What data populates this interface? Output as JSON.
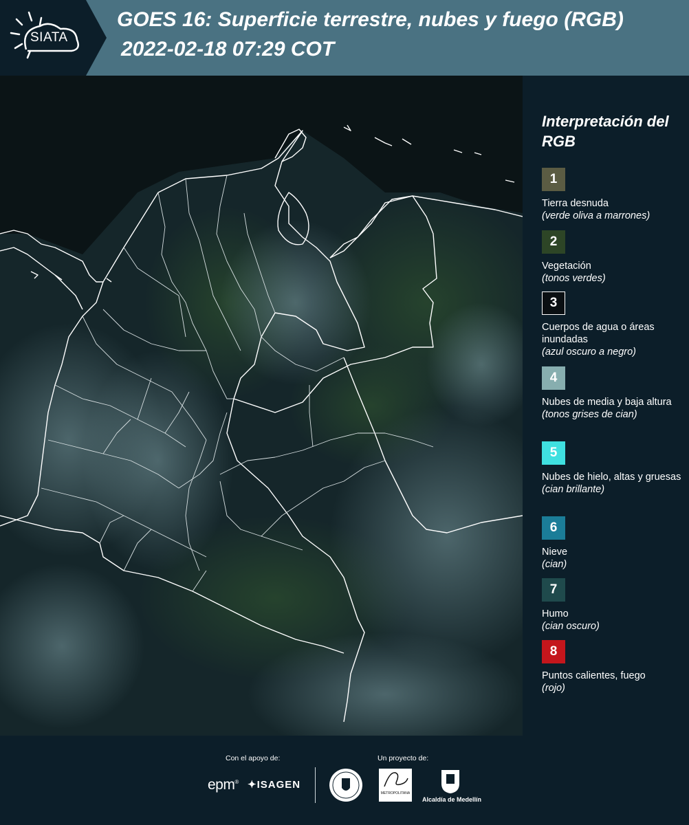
{
  "header": {
    "logo": "SIATA",
    "title_line1": "GOES 16: Superficie terrestre, nubes y fuego (RGB)",
    "title_line2": "2022-02-18 07:29 COT"
  },
  "map": {
    "base_color": "#0e1a1c",
    "border_color": "#ffffff"
  },
  "legend": {
    "title": "Interpretación del RGB",
    "items": [
      {
        "number": "1",
        "label": "Tierra desnuda",
        "note": "(verde oliva a marrones)",
        "color": "#5b5c43"
      },
      {
        "number": "2",
        "label": "Vegetación",
        "note": "(tonos verdes)",
        "color": "#2d4526"
      },
      {
        "number": "3",
        "label": "Cuerpos de agua o áreas inundadas",
        "note": "(azul oscuro a negro)",
        "color": "#0a0f12"
      },
      {
        "number": "4",
        "label": "Nubes de media y baja altura",
        "note": "(tonos grises de cian)",
        "color": "#87aeaf"
      },
      {
        "number": "5",
        "label": "Nubes de hielo, altas y gruesas",
        "note": "(cian brillante)",
        "color": "#3fe0e0"
      },
      {
        "number": "6",
        "label": "Nieve",
        "note": "(cian)",
        "color": "#1b7d98"
      },
      {
        "number": "7",
        "label": "Humo",
        "note": "(cian oscuro)",
        "color": "#1f4a4c"
      },
      {
        "number": "8",
        "label": "Puntos calientes, fuego",
        "note": "(rojo)",
        "color": "#c4161c"
      }
    ]
  },
  "footer": {
    "support_label": "Con el apoyo de:",
    "project_label": "Un proyecto de:",
    "sponsor_epm": "epm",
    "sponsor_isagen": "ISAGEN",
    "partner_metropolitana": "METROPOLITANA",
    "partner_medellin": "Alcaldía de Medellín"
  }
}
